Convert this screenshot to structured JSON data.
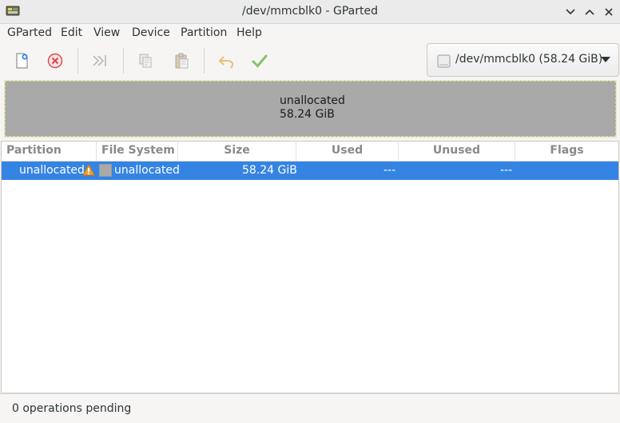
{
  "window": {
    "title": "/dev/mmcblk0 - GParted"
  },
  "menubar": {
    "items": [
      "GParted",
      "Edit",
      "View",
      "Device",
      "Partition",
      "Help"
    ]
  },
  "toolbar": {
    "icons": [
      "new-partition-icon",
      "delete-partition-icon",
      "resize-move-icon",
      "copy-icon",
      "paste-icon",
      "undo-icon",
      "apply-icon"
    ],
    "device_selector": "/dev/mmcblk0 (58.24 GiB)"
  },
  "disk_map": {
    "label": "unallocated",
    "size": "58.24 GiB",
    "color": "#a9a9a9"
  },
  "partition_table": {
    "columns": [
      "Partition",
      "File System",
      "Size",
      "Used",
      "Unused",
      "Flags"
    ],
    "rows": [
      {
        "partition": "unallocated",
        "file_system": "unallocated",
        "size": "58.24 GiB",
        "used": "---",
        "unused": "---",
        "flags": ""
      }
    ],
    "selected_row_color": "#3584e4"
  },
  "statusbar": {
    "text": "0 operations pending"
  }
}
